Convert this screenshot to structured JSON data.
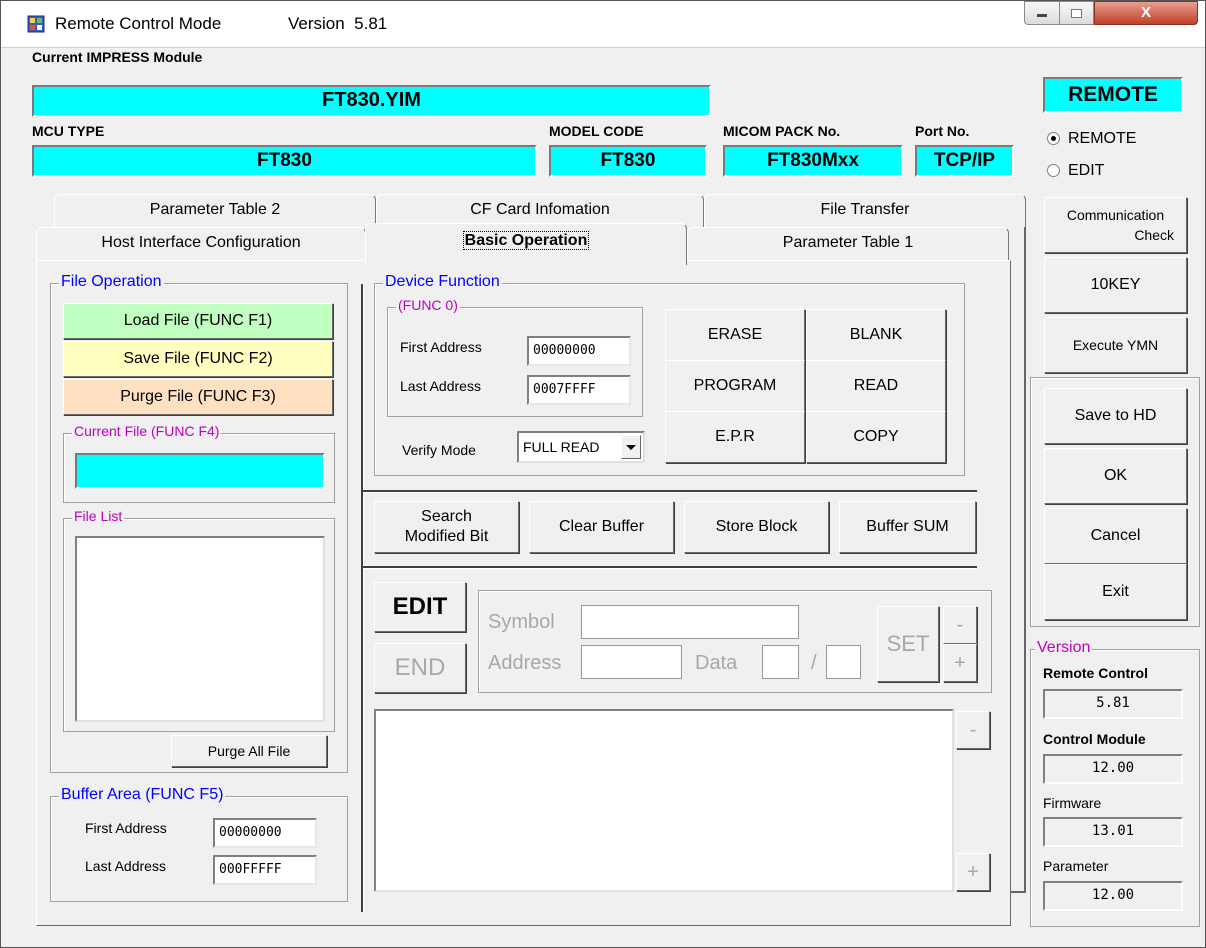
{
  "window": {
    "title": "Remote Control Mode",
    "version_text": "Version  5.81",
    "controls": {
      "minimize": "–",
      "maximize": "▢",
      "close": "X"
    }
  },
  "header": {
    "impress_label": "Current IMPRESS Module",
    "impress_value": "FT830.YIM",
    "mcu_label": "MCU TYPE",
    "mcu_value": "FT830",
    "model_label": "MODEL CODE",
    "model_value": "FT830",
    "micom_label": "MICOM PACK No.",
    "micom_value": "FT830Mxx",
    "port_label": "Port No.",
    "port_value": "TCP/IP"
  },
  "mode": {
    "badge": "REMOTE",
    "options": [
      {
        "label": "REMOTE",
        "selected": true
      },
      {
        "label": "EDIT",
        "selected": false
      }
    ]
  },
  "tabs": {
    "back_row": [
      "Parameter Table 2",
      "CF Card Infomation",
      "File Transfer"
    ],
    "front_row": [
      "Host Interface Configuration",
      "Basic Operation",
      "Parameter Table 1"
    ],
    "active": "Basic Operation"
  },
  "file_operation": {
    "title": "File Operation",
    "load": "Load File  (FUNC F1)",
    "save": "Save File  (FUNC F2)",
    "purge": "Purge File (FUNC F3)",
    "current_file_label": "Current File (FUNC F4)",
    "current_file_value": "",
    "file_list_label": "File List",
    "purge_all": "Purge All File",
    "colors": {
      "load": "#c0ffc0",
      "save": "#ffffc0",
      "purge": "#ffe0c0"
    }
  },
  "buffer_area": {
    "title": "Buffer Area (FUNC F5)",
    "first_label": "First Address",
    "first_value": "00000000",
    "last_label": "Last Address",
    "last_value": "000FFFFF"
  },
  "device_function": {
    "title": "Device Function",
    "func0": "(FUNC 0)",
    "first_label": "First Address",
    "first_value": "00000000",
    "last_label": "Last Address",
    "last_value": "0007FFFF",
    "verify_label": "Verify Mode",
    "verify_value": "FULL READ",
    "buttons": [
      "ERASE",
      "BLANK",
      "PROGRAM",
      "READ",
      "E.P.R",
      "COPY"
    ]
  },
  "buffer_buttons": {
    "search": "Search\nModified Bit",
    "clear": "Clear Buffer",
    "store": "Store Block",
    "sum": "Buffer SUM"
  },
  "editor": {
    "edit": "EDIT",
    "end": "END",
    "symbol_label": "Symbol",
    "address_label": "Address",
    "data_label": "Data",
    "slash": "/",
    "set": "SET",
    "minus": "-",
    "plus": "+"
  },
  "right_panel": {
    "comm_check": "Communication\nCheck",
    "tenkey": "10KEY",
    "exec_ymn": "Execute YMN",
    "save_hd": "Save to HD",
    "ok": "OK",
    "cancel": "Cancel",
    "exit": "Exit"
  },
  "version_box": {
    "title": "Version",
    "remote_label": "Remote Control",
    "remote_value": "5.81",
    "module_label": "Control Module",
    "module_value": "12.00",
    "firmware_label": "Firmware",
    "firmware_value": "13.01",
    "parameter_label": "Parameter",
    "parameter_value": "12.00"
  }
}
